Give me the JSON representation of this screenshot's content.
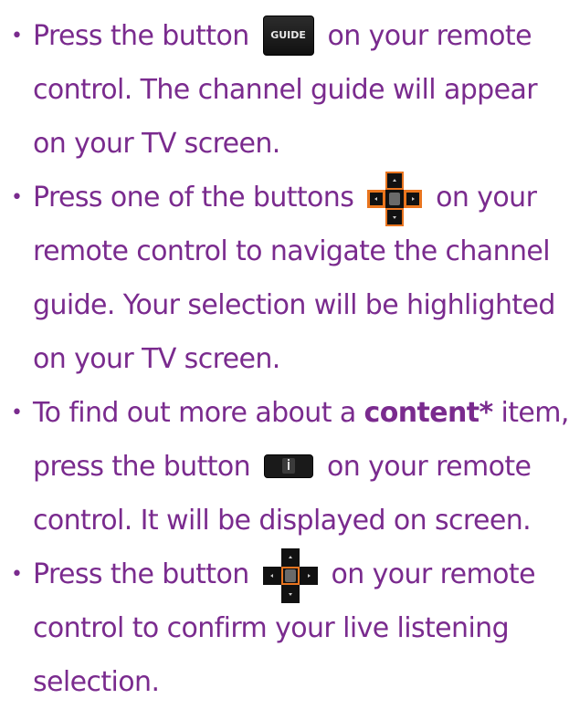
{
  "steps": [
    {
      "lines": [
        {
          "before": "Press the button",
          "after": "on your remote"
        },
        {
          "text": "control.  The channel guide will appear"
        },
        {
          "text": "on your TV screen."
        }
      ],
      "icon": {
        "name": "guide-button-icon",
        "label": "GUIDE"
      }
    },
    {
      "lines": [
        {
          "before": "Press one of the buttons",
          "after": "on your"
        },
        {
          "text": "remote control to navigate the channel"
        },
        {
          "text": "guide. Your selection will be highlighted"
        },
        {
          "text": "on your TV screen."
        }
      ],
      "icon": {
        "name": "navigation-dpad-icon"
      }
    },
    {
      "lines": [
        {
          "before": "To find out more about a",
          "bold": "content*",
          "after": "item,"
        },
        {
          "before": "press the button",
          "after": "on your remote"
        },
        {
          "text": "control. It will be displayed on screen."
        }
      ],
      "icon": {
        "name": "info-button-icon"
      }
    },
    {
      "lines": [
        {
          "before": "Press the button",
          "after": "on your remote"
        },
        {
          "text": "control to confirm your live listening"
        },
        {
          "text": "selection."
        }
      ],
      "icon": {
        "name": "ok-button-icon"
      }
    }
  ],
  "bullet": "•",
  "colors": {
    "text": "#7a2b8e",
    "highlight": "#e8741f",
    "button": "#111111"
  }
}
